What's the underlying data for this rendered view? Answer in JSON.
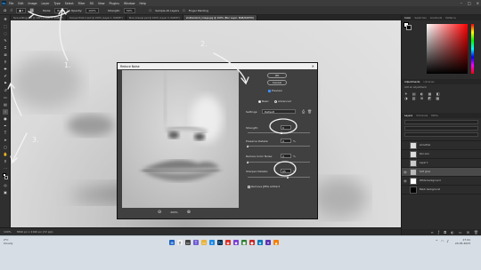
{
  "menubar": {
    "items": [
      "File",
      "Edit",
      "Image",
      "Layer",
      "Type",
      "Select",
      "Filter",
      "3D",
      "View",
      "Plugins",
      "Window",
      "Help"
    ]
  },
  "options_bar": {
    "mode_label": "Mode:",
    "mode_value": "Brush",
    "opacity_label": "Opacity:",
    "opacity_value": "100%",
    "strength_label": "Strength:",
    "strength_value": "50%",
    "sample_label": "Sample All Layers",
    "finger_label": "Finger Painting"
  },
  "tabs": [
    {
      "label": "face-editing.psd @ 100% (Layer 0, RGB/8*)"
    },
    {
      "label": "face-portrait-2.psd @ 100% (Layer 1, RGB/8*)"
    },
    {
      "label": "face-closeup.psd @ 100% (Layer 0, RGB/8*)"
    },
    {
      "label": "shutterstock_image.jpg @ 100% (Blur Layer, RGB/8/CMYK)"
    }
  ],
  "status": {
    "zoom": "100%",
    "doc_info": "3840 px x 2160 px (72 ppi)"
  },
  "panels": {
    "color_tabs": [
      "Color",
      "Swatches",
      "Gradients",
      "Patterns"
    ],
    "adjust_tabs": [
      "Adjustments",
      "Libraries"
    ],
    "adjust_hint": "Add an adjustment",
    "layers_tabs": [
      "Layers",
      "Channels",
      "Paths"
    ],
    "layers": [
      {
        "name": "smoother"
      },
      {
        "name": "blur-one"
      },
      {
        "name": "Layer 1"
      },
      {
        "name": "Soft glow"
      },
      {
        "name": "White background"
      },
      {
        "name": "Black background"
      }
    ]
  },
  "dialog": {
    "title": "Reduce Noise",
    "ok": "OK",
    "cancel": "Cancel",
    "preview": "Preview",
    "basic": "Basic",
    "advanced": "Advanced",
    "settings_label": "Settings:",
    "settings_value": "Default",
    "strength_label": "Strength:",
    "strength_value": "6",
    "details_label": "Preserve Details:",
    "details_value": "0",
    "color_label": "Reduce Color Noise:",
    "color_value": "0",
    "sharpen_label": "Sharpen Details:",
    "sharpen_value": "65",
    "jpeg_label": "Remove JPEG Artifact",
    "zoom_value": "200%",
    "pct_sign": "%"
  },
  "annotations": {
    "one": "1.",
    "two": "2.",
    "three": "3."
  },
  "taskbar": {
    "weather_temp": "2°C",
    "weather_text": "Cloudy",
    "time": "17:41",
    "date": "24.05.2023"
  }
}
